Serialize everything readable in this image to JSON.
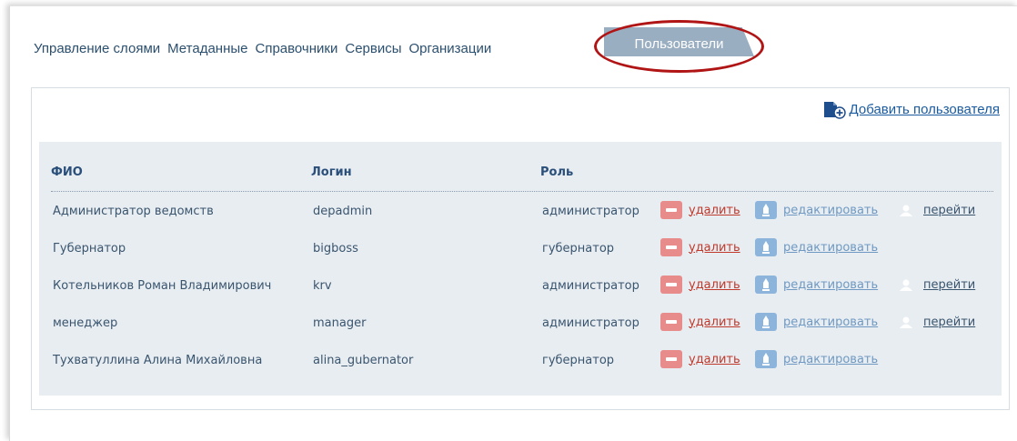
{
  "nav": {
    "tabs": [
      {
        "label": "Управление слоями",
        "active": false
      },
      {
        "label": "Метаданные",
        "active": false
      },
      {
        "label": "Справочники",
        "active": false
      },
      {
        "label": "Сервисы",
        "active": false
      },
      {
        "label": "Организации",
        "active": false
      },
      {
        "label": "Пользователи",
        "active": true
      }
    ]
  },
  "add_user": {
    "label": "Добавить пользователя",
    "icon": "add-user-icon"
  },
  "table": {
    "headers": {
      "name": "ФИО",
      "login": "Логин",
      "role": "Роль"
    },
    "action_labels": {
      "delete": "удалить",
      "edit": "редактировать",
      "goto": "перейти"
    },
    "rows": [
      {
        "name": "Администратор ведомств",
        "login": "depadmin",
        "role": "администратор",
        "actions": [
          "delete",
          "edit",
          "goto"
        ]
      },
      {
        "name": "Губернатор",
        "login": "bigboss",
        "role": "губернатор",
        "actions": [
          "delete",
          "edit"
        ]
      },
      {
        "name": "Котельников Роман Владимирович",
        "login": "krv",
        "role": "администратор",
        "actions": [
          "delete",
          "edit",
          "goto"
        ]
      },
      {
        "name": "менеджер",
        "login": "manager",
        "role": "администратор",
        "actions": [
          "delete",
          "edit",
          "goto"
        ]
      },
      {
        "name": "Тухватуллина Алина Михайловна",
        "login": "alina_gubernator",
        "role": "губернатор",
        "actions": [
          "delete",
          "edit"
        ]
      }
    ]
  },
  "colors": {
    "active_tab": "#9aaec2",
    "highlight_ellipse": "#b01414",
    "delete": "#e88b8b",
    "edit": "#8db5dc",
    "goto": "#8dc48d"
  }
}
